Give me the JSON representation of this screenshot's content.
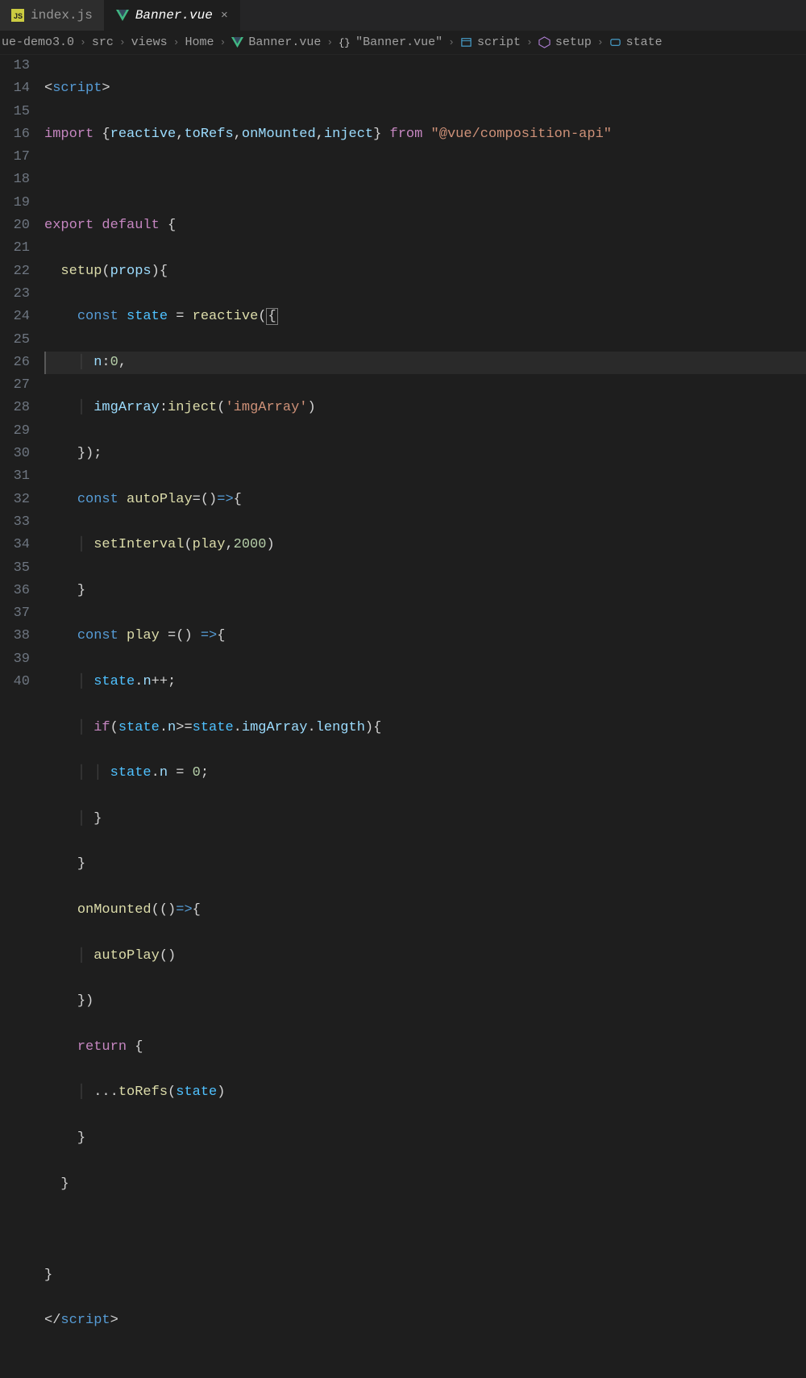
{
  "tabs": {
    "inactive": {
      "name": "index.js"
    },
    "active": {
      "name": "Banner.vue"
    }
  },
  "breadcrumb": {
    "p0": "ue-demo3.0",
    "p1": "src",
    "p2": "views",
    "p3": "Home",
    "p4": "Banner.vue",
    "p5": "\"Banner.vue\"",
    "p6": "script",
    "p7": "setup",
    "p8": "state"
  },
  "lines": {
    "l13": "13",
    "l14": "14",
    "l15": "15",
    "l16": "16",
    "l17": "17",
    "l18": "18",
    "l19": "19",
    "l20": "20",
    "l21": "21",
    "l22": "22",
    "l23": "23",
    "l24": "24",
    "l25": "25",
    "l26": "26",
    "l27": "27",
    "l28": "28",
    "l29": "29",
    "l30": "30",
    "l31": "31",
    "l32": "32",
    "l33": "33",
    "l34": "34",
    "l35": "35",
    "l36": "36",
    "l37": "37",
    "l38": "38",
    "l39": "39",
    "l40": "40"
  },
  "code": {
    "script_open": "script",
    "import": "import",
    "reactive": "reactive",
    "toRefs": "toRefs",
    "onMounted": "onMounted",
    "inject": "inject",
    "from": "from",
    "pkg": "\"@vue/composition-api\"",
    "export": "export",
    "default": "default",
    "setup": "setup",
    "props": "props",
    "const": "const",
    "state": "state",
    "n_key": "n",
    "zero": "0",
    "imgArray": "imgArray",
    "imgArrayStr": "'imgArray'",
    "autoPlay": "autoPlay",
    "setInterval": "setInterval",
    "play": "play",
    "twoThousand": "2000",
    "if": "if",
    "length": "length",
    "return": "return",
    "spread_toRefs": "toRefs",
    "script_close": "script"
  }
}
